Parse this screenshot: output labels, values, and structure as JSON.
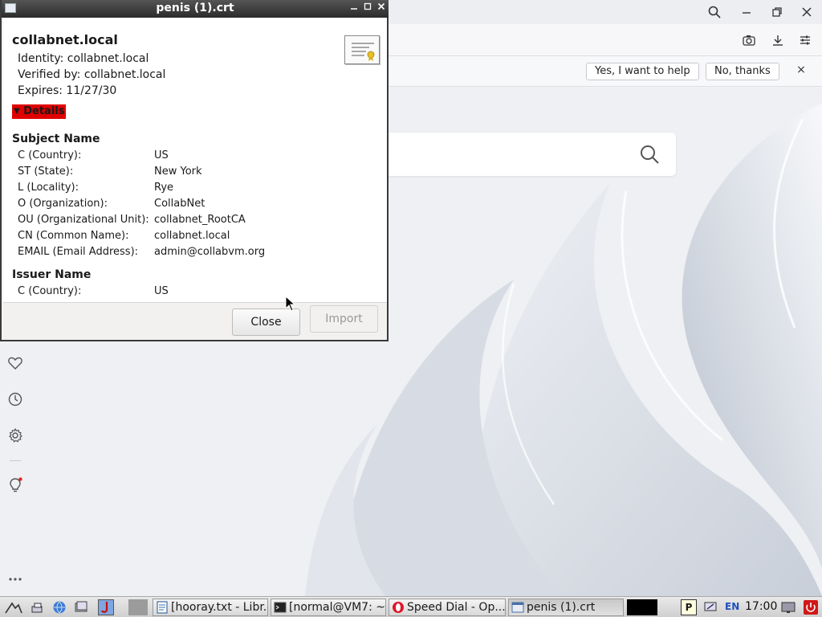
{
  "dialog": {
    "title": "penis (1).crt",
    "cert_name": "collabnet.local",
    "identity": "Identity: collabnet.local",
    "verified_by": "Verified by: collabnet.local",
    "expires": "Expires: 11/27/30",
    "details_label": "Details",
    "subject": {
      "heading": "Subject Name",
      "rows": [
        {
          "label": "C (Country):",
          "value": "US"
        },
        {
          "label": "ST (State):",
          "value": "New York"
        },
        {
          "label": "L (Locality):",
          "value": "Rye"
        },
        {
          "label": "O (Organization):",
          "value": "CollabNet"
        },
        {
          "label": "OU (Organizational Unit):",
          "value": "collabnet_RootCA"
        },
        {
          "label": "CN (Common Name):",
          "value": "collabnet.local"
        },
        {
          "label": "EMAIL (Email Address):",
          "value": "admin@collabvm.org"
        }
      ]
    },
    "issuer": {
      "heading": "Issuer Name",
      "rows": [
        {
          "label": "C (Country):",
          "value": "US"
        }
      ]
    },
    "close_label": "Close",
    "import_label": "Import"
  },
  "browser": {
    "infobar": {
      "yes_label": "Yes, I want to help",
      "no_label": "No, thanks",
      "close_glyph": "×"
    }
  },
  "taskbar": {
    "tasks": [
      {
        "label": "[hooray.txt - Libr..."
      },
      {
        "label": "[normal@VM7: ~]"
      },
      {
        "label": "Speed Dial - Op..."
      },
      {
        "label": "penis (1).crt"
      }
    ],
    "lang": "EN",
    "clock": "17:00"
  },
  "icons": {
    "search": "search-icon",
    "camera": "camera-icon",
    "download": "download-icon",
    "settings": "sliders-icon",
    "heart": "heart-icon",
    "history": "clock-icon",
    "gear": "gear-icon",
    "tips": "lightbulb-icon",
    "more": "more-icon"
  },
  "colors": {
    "details_highlight": "#e00000",
    "titlebar": "#2b2b2b"
  }
}
